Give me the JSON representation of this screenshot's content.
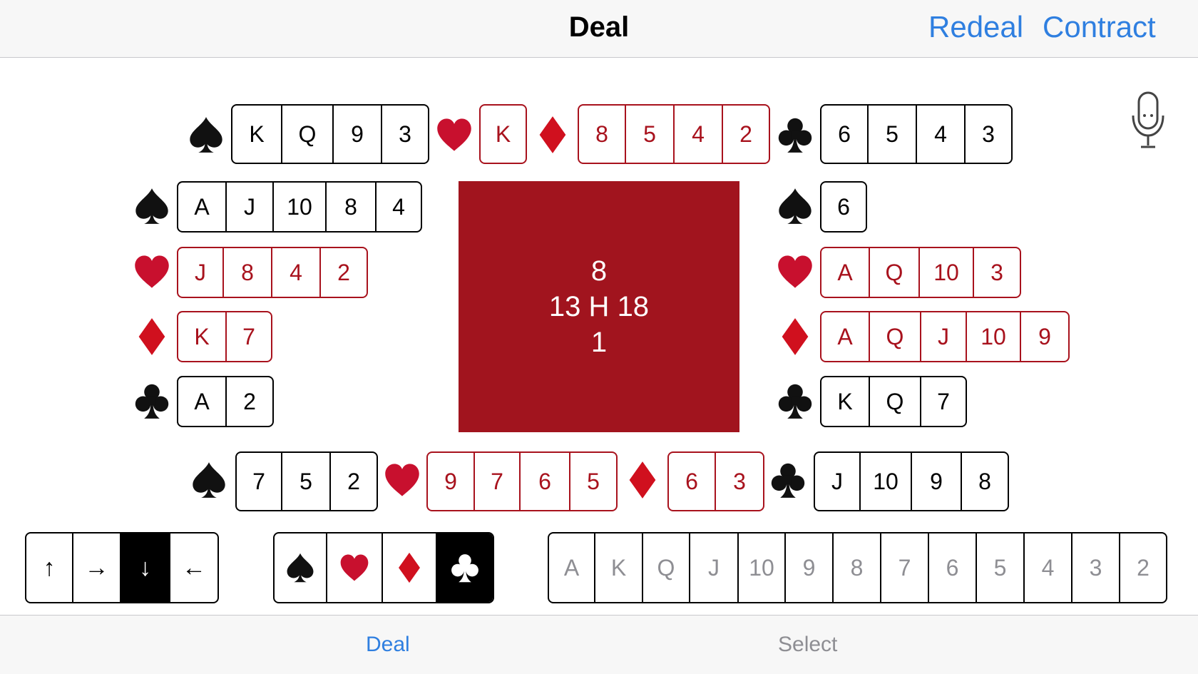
{
  "nav": {
    "title": "Deal",
    "redeal": "Redeal",
    "contract": "Contract"
  },
  "colors": {
    "accent": "#2f7fe0",
    "card_red": "#a8121d",
    "center_bg": "#a1141e"
  },
  "hands": {
    "north": {
      "spades": [
        "K",
        "Q",
        "9",
        "3"
      ],
      "hearts": [
        "K"
      ],
      "diamonds": [
        "8",
        "5",
        "4",
        "2"
      ],
      "clubs": [
        "6",
        "5",
        "4",
        "3"
      ]
    },
    "west": {
      "spades": [
        "A",
        "J",
        "10",
        "8",
        "4"
      ],
      "hearts": [
        "J",
        "8",
        "4",
        "2"
      ],
      "diamonds": [
        "K",
        "7"
      ],
      "clubs": [
        "A",
        "2"
      ]
    },
    "east": {
      "spades": [
        "6"
      ],
      "hearts": [
        "A",
        "Q",
        "10",
        "3"
      ],
      "diamonds": [
        "A",
        "Q",
        "J",
        "10",
        "9"
      ],
      "clubs": [
        "K",
        "Q",
        "7"
      ]
    },
    "south": {
      "spades": [
        "7",
        "5",
        "2"
      ],
      "hearts": [
        "9",
        "7",
        "6",
        "5"
      ],
      "diamonds": [
        "6",
        "3"
      ],
      "clubs": [
        "J",
        "10",
        "9",
        "8"
      ]
    }
  },
  "points": {
    "north": "8",
    "west": "13",
    "trump": "H",
    "east": "18",
    "south": "1"
  },
  "direction_selector": {
    "options": [
      "↑",
      "→",
      "↓",
      "←"
    ],
    "selected_index": 2
  },
  "suit_selector": {
    "options": [
      "spade-icon",
      "heart-icon",
      "diamond-icon",
      "club-icon"
    ],
    "selected_index": 3
  },
  "rank_selector": [
    "A",
    "K",
    "Q",
    "J",
    "10",
    "9",
    "8",
    "7",
    "6",
    "5",
    "4",
    "3",
    "2"
  ],
  "tabs": {
    "deal": "Deal",
    "select": "Select"
  },
  "mic": "microphone-icon"
}
